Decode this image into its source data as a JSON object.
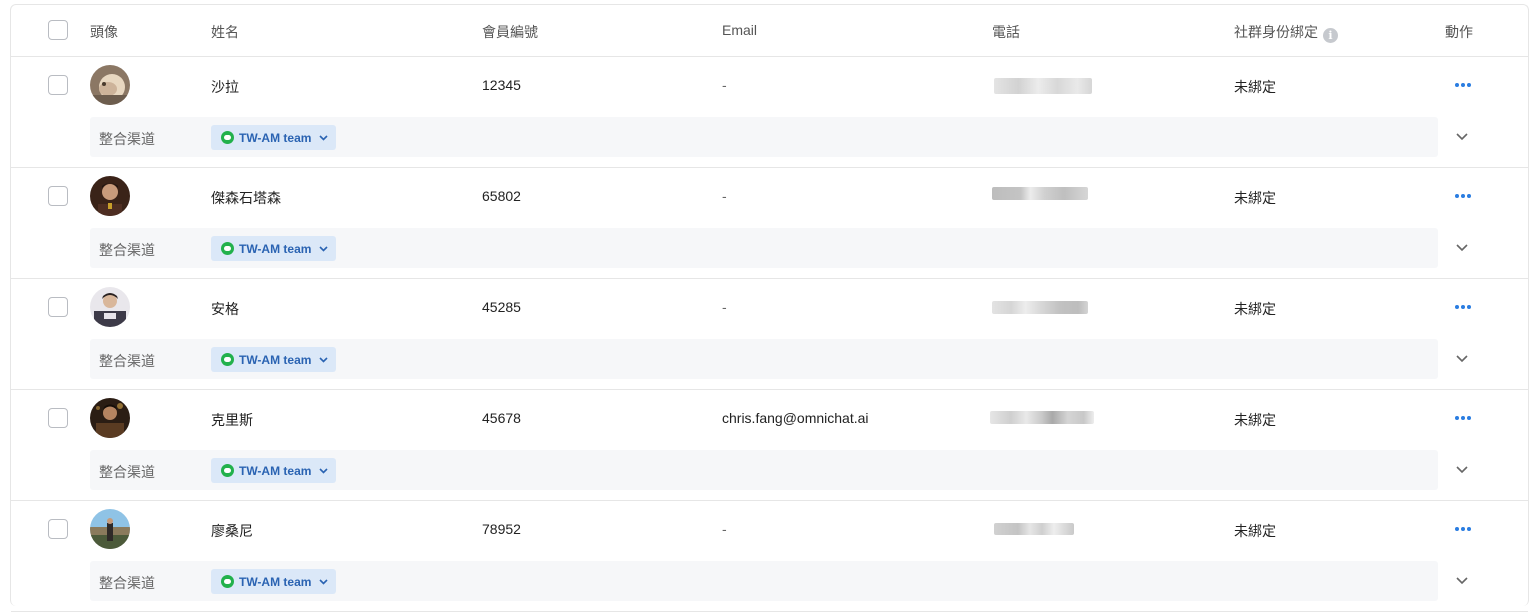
{
  "columns": {
    "avatar": "頭像",
    "name": "姓名",
    "member_id": "會員編號",
    "email": "Email",
    "phone": "電話",
    "social_binding": "社群身份綁定",
    "actions": "動作"
  },
  "info_icon": "i",
  "sub_label": "整合渠道",
  "rows": [
    {
      "name": "沙拉",
      "member_id": "12345",
      "email": "-",
      "binding": "未綁定",
      "channel": "TW-AM team"
    },
    {
      "name": "傑森石塔森",
      "member_id": "65802",
      "email": "-",
      "binding": "未綁定",
      "channel": "TW-AM team"
    },
    {
      "name": "安格",
      "member_id": "45285",
      "email": "-",
      "binding": "未綁定",
      "channel": "TW-AM team"
    },
    {
      "name": "克里斯",
      "member_id": "45678",
      "email": "chris.fang@omnichat.ai",
      "binding": "未綁定",
      "channel": "TW-AM team"
    },
    {
      "name": "廖桑尼",
      "member_id": "78952",
      "email": "-",
      "binding": "未綁定",
      "channel": "TW-AM team"
    }
  ],
  "icons": {
    "more": "more-horizontal-icon",
    "expand": "chevron-down-icon",
    "channel": "line-icon",
    "info": "info-icon"
  },
  "colors": {
    "accent": "#2a7de1",
    "tag_bg": "#dbe8f8",
    "tag_text": "#2a63b2",
    "line_green": "#22b14c"
  }
}
